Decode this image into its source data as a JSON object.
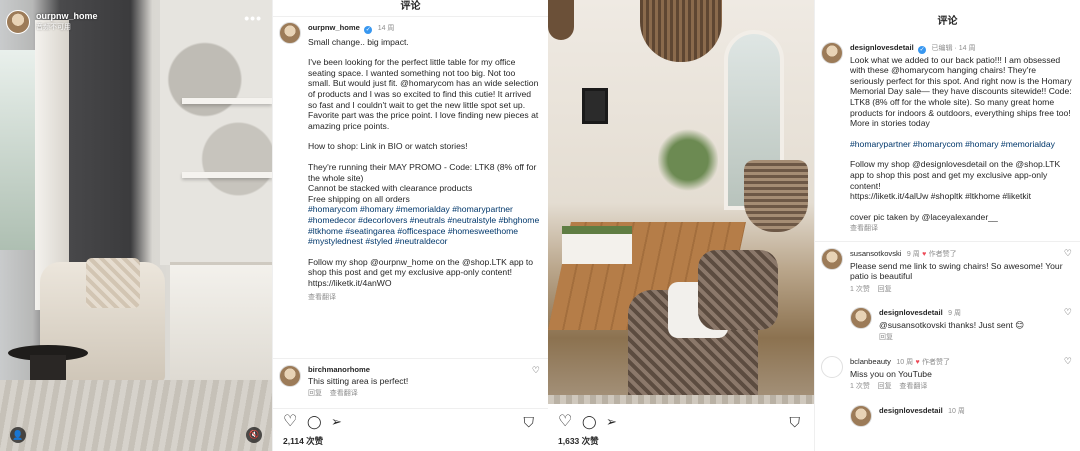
{
  "post_left": {
    "username": "ourpnw_home",
    "audio_label": "音频不可用",
    "more": "•••",
    "panel_title": "评论",
    "caption_user": "ourpnw_home",
    "caption_time": "14 周",
    "caption_lines": [
      "Small change.. big impact.",
      "",
      "I've been looking for the perfect little table for my office seating space. I wanted something not too big. Not too small. But would just fit. @homarycom has an wide selection of products and I was so excited to find this cutie! It arrived so fast and I couldn't wait to get the new little spot set up. Favorite part was the price point. I love finding new pieces at amazing price points.",
      "",
      "How to shop: Link in BIO or watch stories!",
      "",
      "They're running their MAY PROMO - Code: LTK8 (8% off for the whole site)",
      "Cannot be stacked with clearance products",
      "Free shipping on all orders",
      "#homarycom #homary #memorialday #homarypartner #homedecor #decorlovers #neutrals #neutralstyle #bhghome #ltkhome #seatingarea #officespace #homesweethome #mystylednest #styled #neutraldecor",
      "",
      "Follow my shop @ourpnw_home on the @shop.LTK app to shop this post and get my exclusive app-only content!",
      "https://liketk.it/4anWO"
    ],
    "see_translation": "查看翻译",
    "comment_user": "birchmanorhome",
    "comment_text": "This sitting area is perfect!",
    "comment_reply": "回复",
    "comment_translate": "查看翻译",
    "likes": "2,114 次赞"
  },
  "post_right": {
    "panel_title": "评论",
    "caption_user": "designlovesdetail",
    "edited": "已编辑 · 14 周",
    "caption_lines": [
      "Look what we added to our back patio!!! I am obsessed with these @homarycom hanging chairs! They're seriously perfect for this spot. And right now is the Homary Memorial Day sale— they have discounts sitewide!! Code: LTK8 (8% off for the whole site). So many great home products for indoors & outdoors, everything ships free too! More in stories today",
      "",
      "#homarypartner #homarycom #homary #memorialday",
      "",
      "Follow my shop @designlovesdetail on the @shop.LTK app to shop this post and get my exclusive app-only content!",
      "https://liketk.it/4alUw #shopltk #ltkhome #liketkit",
      "",
      "cover pic taken by @laceyalexander__"
    ],
    "see_translation": "查看翻译",
    "comments": [
      {
        "user": "susansotkovski",
        "time": "9 周",
        "liked": "作者赞了",
        "text": "Please send me link to swing chairs! So awesome! Your patio is beautiful",
        "likes": "1 次赞",
        "reply": "回复"
      },
      {
        "user": "designlovesdetail",
        "time": "9 周",
        "text": "@susansotkovski thanks! Just sent 😊",
        "reply": "回复"
      },
      {
        "user": "bclanbeauty",
        "time": "10 周",
        "liked": "作者赞了",
        "text": "Miss you on YouTube",
        "likes": "1 次赞",
        "reply": "回复",
        "translate": "查看翻译"
      },
      {
        "user": "designlovesdetail",
        "time": "10 周"
      }
    ],
    "likes": "1,633 次赞"
  },
  "icons": {
    "heart": "♡",
    "comment": "◯",
    "share": "➢",
    "bookmark": "⛉",
    "tag": "👤",
    "mute": "🔇",
    "verified": "✓",
    "red_heart": "♥"
  },
  "colors": {
    "link": "#00376b",
    "verified": "#3897f0",
    "meta": "#8e8e8e",
    "like_red": "#ed4956"
  }
}
